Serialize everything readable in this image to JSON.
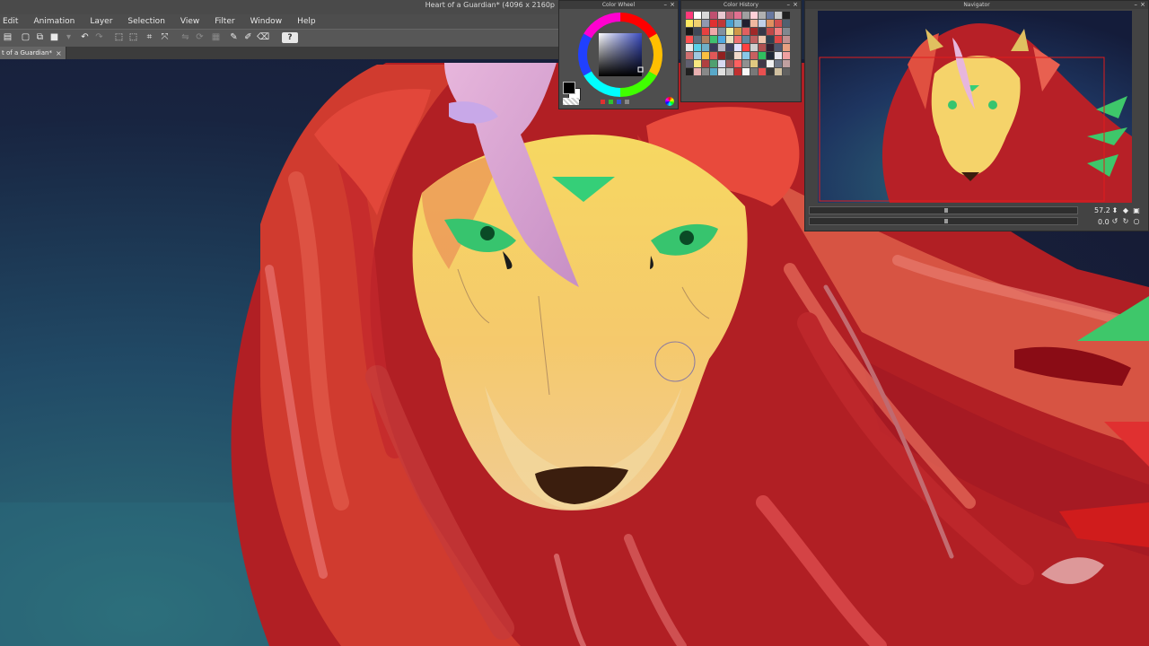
{
  "window": {
    "title": "Heart of a Guardian* (4096 x 2160p",
    "menu": [
      "Edit",
      "Animation",
      "Layer",
      "Selection",
      "View",
      "Filter",
      "Window",
      "Help"
    ],
    "document_tab": {
      "label": "t of a Guardian*",
      "close": "×"
    }
  },
  "toolbar": {
    "icons": [
      "new-icon",
      "copy-icon",
      "paste-icon",
      "undo-icon",
      "redo-icon",
      "select-icon",
      "transform-icon",
      "help-icon"
    ],
    "help_label": "?"
  },
  "panels": {
    "color_wheel": {
      "title": "Color Wheel"
    },
    "color_history": {
      "title": "Color History"
    },
    "navigator": {
      "title": "Navigator",
      "zoom": "57.2",
      "rotation": "0.0"
    }
  },
  "colors": {
    "main": "#000000",
    "sub": "#ffffff",
    "accent_blue": "#2a3a7a",
    "canvas_bg": "#1b2740"
  },
  "color_history_swatches": [
    "#ff3a7a",
    "#ffffff",
    "#d8d8d8",
    "#c05070",
    "#e8c8d0",
    "#b86878",
    "#e07090",
    "#a0a0a0",
    "#ffd0d8",
    "#b0b0b0",
    "#6878a0",
    "#c8c8c8",
    "#202020",
    "#ffe860",
    "#f0d070",
    "#9098b0",
    "#e03030",
    "#c03838",
    "#48a0d0",
    "#88b8d0",
    "#202030",
    "#f0b8a0",
    "#c0d0e8",
    "#e09060",
    "#d05050",
    "#506070",
    "#181818",
    "#404858",
    "#e84040",
    "#f0a8a8",
    "#8090a0",
    "#f0f0a0",
    "#d09848",
    "#e06060",
    "#a02828",
    "#383848",
    "#c04848",
    "#f08080",
    "#808890",
    "#ff5050",
    "#607080",
    "#b08060",
    "#40c070",
    "#50a8e0",
    "#e8e0c0",
    "#f07070",
    "#6088a0",
    "#c06060",
    "#f0c8b0",
    "#304050",
    "#e04848",
    "#c09090",
    "#e8e8e8",
    "#58d0e8",
    "#70b0c8",
    "#3a3a5a",
    "#b8b8c8",
    "#404060",
    "#e0e0ff",
    "#ff4040",
    "#d0d0d0",
    "#b05050",
    "#302030",
    "#505870",
    "#e8a080",
    "#d07070",
    "#a0c8e0",
    "#f8c040",
    "#e05858",
    "#902020",
    "#404040",
    "#f0d8c8",
    "#88c8e8",
    "#c86060",
    "#30c060",
    "#202838",
    "#e8e8f0",
    "#f0a0a0",
    "#606070",
    "#f8e880",
    "#b04040",
    "#50a070",
    "#d8d8f0",
    "#a05858",
    "#ff6060",
    "#909090",
    "#e0c880",
    "#403848",
    "#f0f0f0",
    "#707888",
    "#c0a0a0",
    "#202020",
    "#e8b0b0",
    "#888888",
    "#58a8c8",
    "#e0e0e0",
    "#b8b8b8",
    "#c03030",
    "#f8f8f8",
    "#787878",
    "#e85050",
    "#383838",
    "#d0c0a0",
    "#606060"
  ]
}
